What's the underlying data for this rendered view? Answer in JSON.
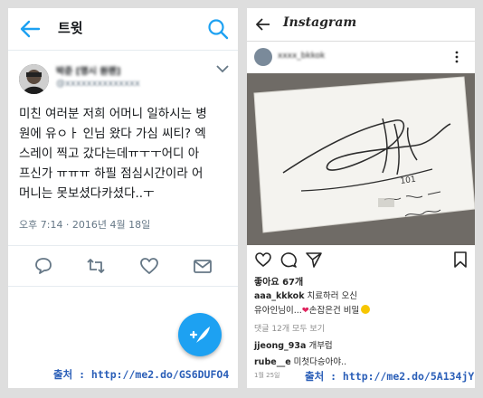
{
  "twitter": {
    "header": {
      "title": "트윗"
    },
    "tweet": {
      "display_name": "박준 [명시 원랜]",
      "handle": "@xxxxxxxxxxxxxx",
      "body_lines": [
        "미친 여러분 저희 어머니 일하시는 병",
        "원에 유ㅇㅏ 인님 왔다 가심 씨티? 엑",
        "스레이 찍고 갔다는데ㅠㅜㅜ어디 아",
        "프신가 ㅠㅠㅠ 하필 점심시간이라 어",
        "머니는 못보셨다카셨다..ㅜ"
      ],
      "timestamp": "오후 7:14 · 2016년 4월 18일"
    },
    "actions": [
      "reply-icon",
      "retweet-icon",
      "like-icon",
      "mail-icon"
    ],
    "fab_icon": "compose-icon",
    "source": "출처 : http://me2.do/GS6DUFO4",
    "accent": "#1da1f2"
  },
  "instagram": {
    "header": {
      "logo": "Instagram"
    },
    "post": {
      "username": "xxxx_bkkok",
      "photo_text": "101",
      "likes": "좋아요 67개",
      "caption_user": "aaa_kkkok",
      "caption_text_1": " 치료하러 오신",
      "caption_text_2": "유아인님이...",
      "caption_text_3": "손잡은건 비밀",
      "view_comments": "댓글 12개 모두 보기",
      "comments": [
        {
          "user": "jjeong_93a",
          "text": " 개부럽"
        },
        {
          "user": "rube__e",
          "text": " 미첫다승아야.."
        }
      ],
      "date": "1월 25일"
    },
    "source": "출처 : http://me2.do/5A134jY8"
  }
}
